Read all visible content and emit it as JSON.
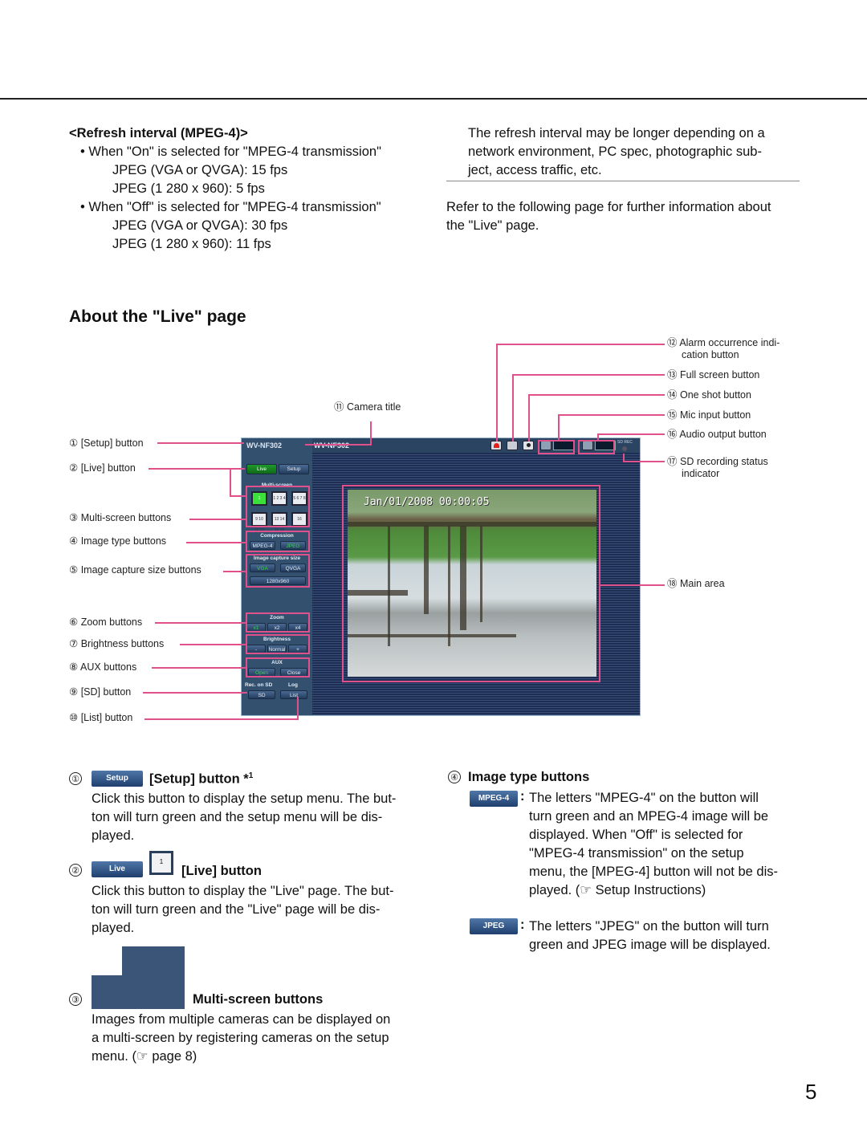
{
  "refresh": {
    "heading": "<Refresh interval (MPEG-4)>",
    "on_bullet": "When \"On\" is selected for \"MPEG-4 transmission\"",
    "on_vga": "JPEG (VGA or QVGA): 15 fps",
    "on_hd": "JPEG (1 280 x 960): 5 fps",
    "off_bullet": "When \"Off\" is selected for \"MPEG-4 transmission\"",
    "off_vga": "JPEG (VGA or QVGA): 30 fps",
    "off_hd": "JPEG (1 280 x 960): 11 fps",
    "note_lines": [
      "The refresh interval may be longer depending on a",
      "network environment, PC spec, photographic sub-",
      "ject, access traffic, etc."
    ],
    "refer_lines": [
      "Refer to the following page for further information about",
      "the \"Live\" page."
    ]
  },
  "section_title": "About the \"Live\" page",
  "callouts_left": [
    {
      "num": "①",
      "label": "[Setup] button"
    },
    {
      "num": "②",
      "label": "[Live] button"
    },
    {
      "num": "③",
      "label": "Multi-screen buttons"
    },
    {
      "num": "④",
      "label": "Image type buttons"
    },
    {
      "num": "⑤",
      "label": "Image capture size buttons"
    },
    {
      "num": "⑥",
      "label": "Zoom buttons"
    },
    {
      "num": "⑦",
      "label": "Brightness buttons"
    },
    {
      "num": "⑧",
      "label": "AUX buttons"
    },
    {
      "num": "⑨",
      "label": "[SD] button"
    },
    {
      "num": "⑩",
      "label": "[List] button"
    }
  ],
  "callout_camera_title": {
    "num": "⑪",
    "label": "Camera title"
  },
  "callouts_right": [
    {
      "num": "⑫",
      "label": "Alarm occurrence indi-",
      "label2": "cation button"
    },
    {
      "num": "⑬",
      "label": "Full screen button"
    },
    {
      "num": "⑭",
      "label": "One shot button"
    },
    {
      "num": "⑮",
      "label": "Mic input button"
    },
    {
      "num": "⑯",
      "label": "Audio output button"
    },
    {
      "num": "⑰",
      "label": "SD recording status",
      "label2": "indicator"
    },
    {
      "num": "⑱",
      "label": "Main area"
    }
  ],
  "screenshot": {
    "side_title": "WV-NF302",
    "camera_title": "WV-NF302",
    "live": "Live",
    "setup": "Setup",
    "multiscreen_label": "Multi-screen",
    "multiscreen_buttons": [
      "1",
      "1 2 3 4",
      "5 6 7 8",
      "9 10 11 12",
      "13 14 15 16",
      "16"
    ],
    "compression_label": "Compression",
    "mpeg4": "MPEG-4",
    "jpeg": "JPEG",
    "capture_label": "Image capture size",
    "vga": "VGA",
    "qvga": "QVGA",
    "hd": "1280x960",
    "zoom_label": "Zoom",
    "zoom_buttons": [
      "x1",
      "x2",
      "x4"
    ],
    "brightness_label": "Brightness",
    "brightness_buttons": [
      "-",
      "Normal",
      "+"
    ],
    "aux_label": "AUX",
    "aux_open": "Open",
    "aux_close": "Close",
    "rec_label": "Rec. on SD",
    "log_label": "Log",
    "sd": "SD",
    "list": "List",
    "sd_rec": "SD REC",
    "timestamp": "Jan/01/2008 00:00:05"
  },
  "desc": {
    "setup": {
      "num": "①",
      "btn": "Setup",
      "title": "[Setup] button *",
      "sup": "1",
      "lines": [
        "Click this button to display the setup menu. The but-",
        "ton will turn green and the setup menu will be dis-",
        "played."
      ]
    },
    "live": {
      "num": "②",
      "btn": "Live",
      "icon": "1",
      "title": "[Live] button",
      "lines": [
        "Click this button to display the \"Live\" page. The but-",
        "ton will turn green and the \"Live\" page will be dis-",
        "played."
      ]
    },
    "multi": {
      "num": "③",
      "title": "Multi-screen buttons",
      "lines": [
        "Images from multiple cameras can be displayed on",
        "a multi-screen by registering cameras on the setup",
        "menu. (☞ page 8)"
      ]
    },
    "imgtype": {
      "num": "④",
      "title": "Image type buttons",
      "mpeg_btn": "MPEG-4",
      "mpeg_lines": [
        "The letters \"MPEG-4\" on the button will",
        "turn green and an MPEG-4 image will be",
        "displayed. When \"Off\" is selected for",
        "\"MPEG-4 transmission\" on the setup",
        "menu, the [MPEG-4] button will not be dis-",
        "played. (☞ Setup Instructions)"
      ],
      "jpeg_btn": "JPEG",
      "jpeg_lines": [
        "The letters \"JPEG\" on the button will turn",
        "green and JPEG image will be displayed."
      ]
    }
  },
  "page_number": "5"
}
